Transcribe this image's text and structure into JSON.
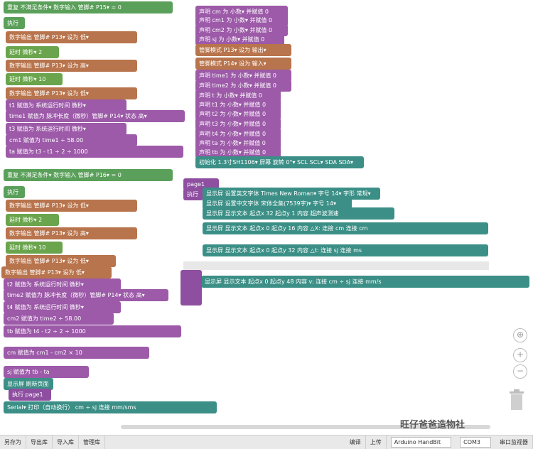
{
  "left_blocks": [
    {
      "text": "重复 不满足条件▾ 数字输入 管脚# P15▾ = 0",
      "cls": "loop",
      "l": 5,
      "t": 2,
      "w": 238
    },
    {
      "text": "执行",
      "cls": "loop",
      "l": 5,
      "t": 24,
      "w": 30
    },
    {
      "text": "数字输出 管脚# P13▾ 设为 低▾",
      "cls": "pin",
      "l": 8,
      "t": 44,
      "w": 185
    },
    {
      "text": "延时 微秒▾ 2",
      "cls": "delay",
      "l": 8,
      "t": 65,
      "w": 75
    },
    {
      "text": "数字输出 管脚# P13▾ 设为 高▾",
      "cls": "pin",
      "l": 8,
      "t": 84,
      "w": 185
    },
    {
      "text": "延时 微秒▾ 10",
      "cls": "delay",
      "l": 8,
      "t": 103,
      "w": 80
    },
    {
      "text": "数字输出 管脚# P13▾ 设为 低▾",
      "cls": "pin",
      "l": 8,
      "t": 123,
      "w": 185
    },
    {
      "text": "t1 赋值为 系统运行时间 微秒▾",
      "cls": "var",
      "l": 8,
      "t": 140,
      "w": 170
    },
    {
      "text": "time1 赋值为 脉冲长度（微秒）管脚# P14▾ 状态 高▾",
      "cls": "var",
      "l": 8,
      "t": 155,
      "w": 252
    },
    {
      "text": "t3 赋值为 系统运行时间 微秒▾",
      "cls": "var",
      "l": 8,
      "t": 173,
      "w": 170
    },
    {
      "text": "cm1 赋值为 time1 ÷ 58.00",
      "cls": "var",
      "l": 8,
      "t": 189,
      "w": 185
    },
    {
      "text": "ta 赋值为 t3 - t1 ÷ 2 ÷ 1000",
      "cls": "var",
      "l": 8,
      "t": 205,
      "w": 250
    },
    {
      "text": "重复 不满足条件▾ 数字输入 管脚# P16▾ = 0",
      "cls": "loop",
      "l": 5,
      "t": 238,
      "w": 238
    },
    {
      "text": "执行",
      "cls": "loop",
      "l": 5,
      "t": 262,
      "w": 30
    },
    {
      "text": "数字输出 管脚# P13▾ 设为 低▾",
      "cls": "pin",
      "l": 8,
      "t": 281,
      "w": 185
    },
    {
      "text": "延时 微秒▾ 2",
      "cls": "delay",
      "l": 8,
      "t": 301,
      "w": 75
    },
    {
      "text": "数字输出 管脚# P13▾ 设为 高▾",
      "cls": "pin",
      "l": 8,
      "t": 320,
      "w": 185
    },
    {
      "text": "延时 微秒▾ 10",
      "cls": "delay",
      "l": 8,
      "t": 340,
      "w": 80
    },
    {
      "text": "数字输出 管脚# P13▾ 设为 低▾",
      "cls": "pin",
      "l": 8,
      "t": 359,
      "w": 155
    },
    {
      "text": "数字输出 管脚# P13▾ 设为 低▾",
      "cls": "pin",
      "l": 2,
      "t": 375,
      "w": 155
    },
    {
      "text": "t2 赋值为 系统运行时间 微秒▾",
      "cls": "var",
      "l": 5,
      "t": 392,
      "w": 165
    },
    {
      "text": "time2 赋值为 脉冲长度（微秒）管脚# P14▾ 状态 高▾",
      "cls": "var",
      "l": 5,
      "t": 407,
      "w": 232
    },
    {
      "text": "t4 赋值为 系统运行时间 微秒▾",
      "cls": "var",
      "l": 5,
      "t": 424,
      "w": 165
    },
    {
      "text": "cm2 赋值为 time2 ÷ 58.00",
      "cls": "var",
      "l": 5,
      "t": 440,
      "w": 155
    },
    {
      "text": "tb 赋值为 t4 - t2 ÷ 2 ÷ 1000",
      "cls": "var",
      "l": 5,
      "t": 458,
      "w": 250
    },
    {
      "text": "cm 赋值为 cm1 - cm2 × 10",
      "cls": "var",
      "l": 5,
      "t": 488,
      "w": 205
    },
    {
      "text": "sj 赋值为 tb - ta",
      "cls": "var",
      "l": 5,
      "t": 515,
      "w": 120
    },
    {
      "text": "显示屏 刷新页面",
      "cls": "disp",
      "l": 5,
      "t": 532,
      "w": 70
    },
    {
      "text": "执行 page1",
      "cls": "proc",
      "l": 12,
      "t": 547,
      "w": 60
    },
    {
      "text": "Serial▾ 打印（自动换行） cm ÷ sj 连接 mm/sms",
      "cls": "serial",
      "l": 5,
      "t": 565,
      "w": 300
    }
  ],
  "right_blocks": [
    {
      "text": "声明 cm 为 小数▾ 并赋值 0",
      "cls": "decl",
      "l": 275,
      "t": 8,
      "w": 130
    },
    {
      "text": "声明 cm1 为 小数▾ 并赋值 0",
      "cls": "decl",
      "l": 275,
      "t": 20,
      "w": 130
    },
    {
      "text": "声明 cm2 为 小数▾ 并赋值 0",
      "cls": "decl",
      "l": 275,
      "t": 34,
      "w": 130
    },
    {
      "text": "声明 sj 为 小数▾ 并赋值 0",
      "cls": "decl",
      "l": 275,
      "t": 47,
      "w": 125
    },
    {
      "text": "管脚模式 P13▾ 设为 输出▾",
      "cls": "pin",
      "l": 275,
      "t": 62,
      "w": 135
    },
    {
      "text": "管脚模式 P14▾ 设为 输入▾",
      "cls": "pin",
      "l": 275,
      "t": 81,
      "w": 135
    },
    {
      "text": "声明 time1 为 小数▾ 并赋值 0",
      "cls": "decl",
      "l": 275,
      "t": 98,
      "w": 135
    },
    {
      "text": "声明 time2 为 小数▾ 并赋值 0",
      "cls": "decl",
      "l": 275,
      "t": 112,
      "w": 135
    },
    {
      "text": "声明 t 为 小数▾ 并赋值 0",
      "cls": "decl",
      "l": 275,
      "t": 126,
      "w": 120
    },
    {
      "text": "声明 t1 为 小数▾ 并赋值 0",
      "cls": "decl",
      "l": 275,
      "t": 139,
      "w": 120
    },
    {
      "text": "声明 t2 为 小数▾ 并赋值 0",
      "cls": "decl",
      "l": 275,
      "t": 152,
      "w": 120
    },
    {
      "text": "声明 t3 为 小数▾ 并赋值 0",
      "cls": "decl",
      "l": 275,
      "t": 166,
      "w": 120
    },
    {
      "text": "声明 t4 为 小数▾ 并赋值 0",
      "cls": "decl",
      "l": 275,
      "t": 180,
      "w": 120
    },
    {
      "text": "声明 ta 为 小数▾ 并赋值 0",
      "cls": "decl",
      "l": 275,
      "t": 193,
      "w": 120
    },
    {
      "text": "声明 tb 为 小数▾ 并赋值 0",
      "cls": "decl",
      "l": 275,
      "t": 206,
      "w": 120
    },
    {
      "text": "初始化 1.3寸SH1106▾ 屏幕 旋转 0°▾ SCL SCL▾ SDA SDA▾",
      "cls": "serial",
      "l": 275,
      "t": 220,
      "w": 237
    },
    {
      "text": "page1",
      "cls": "proc",
      "l": 258,
      "t": 251,
      "w": 50
    },
    {
      "text": "执行",
      "cls": "proc",
      "l": 258,
      "t": 265,
      "w": 28
    },
    {
      "text": "显示屏 设置英文字体 Times New Roman▾ 字号 14▾ 字形 常规▾",
      "cls": "disp",
      "l": 285,
      "t": 264,
      "w": 250
    },
    {
      "text": "显示屏 设置中文字体 宋体全集(7539字)▾ 字号 14▾",
      "cls": "disp",
      "l": 285,
      "t": 278,
      "w": 210
    },
    {
      "text": "显示屏 显示文本 起点x 32 起点y 1 内容 超声波测速",
      "cls": "disp",
      "l": 285,
      "t": 292,
      "w": 270
    },
    {
      "text": "显示屏 显示文本 起点x 0 起点y 16 内容 △X: 连接 cm 连接 cm",
      "cls": "disp",
      "l": 285,
      "t": 313,
      "w": 402
    },
    {
      "text": "显示屏 显示文本 起点x 0 起点y 32 内容 △t: 连接 sj 连接 ms",
      "cls": "disp",
      "l": 285,
      "t": 344,
      "w": 402
    },
    {
      "text": "显示屏 显示文本 起点x 0 起点y 48 内容 v: 连接 cm ÷ sj 连接 mm/s",
      "cls": "disp",
      "l": 283,
      "t": 388,
      "w": 462
    }
  ],
  "toolbar": {
    "items": [
      "另存为",
      "导出库",
      "导入库",
      "管理库",
      "编译",
      "上传"
    ],
    "board": "Arduino HandBit",
    "port": "COM3",
    "monitor": "串口监视器"
  },
  "watermark": "旺仔爸爸造物社",
  "controls": [
    "⊕",
    "+",
    "−"
  ]
}
